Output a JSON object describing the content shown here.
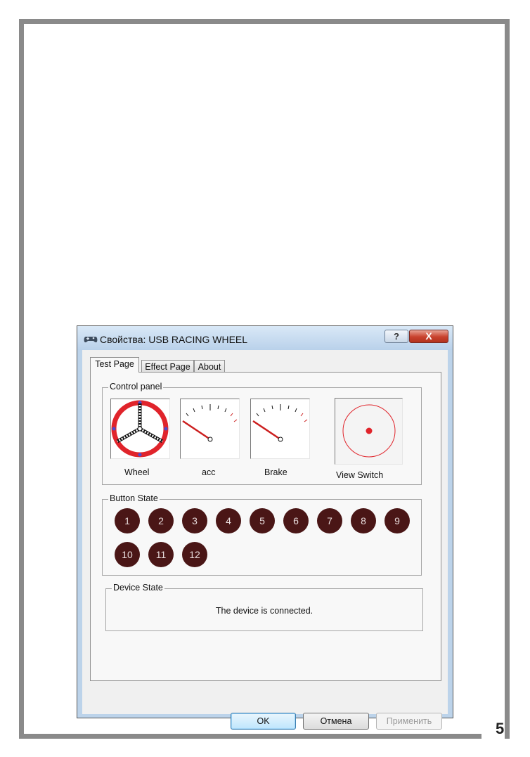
{
  "page": {
    "number": "5"
  },
  "window": {
    "title": "Свойства: USB RACING WHEEL",
    "help_label": "?",
    "close_label": "X"
  },
  "tabs": [
    {
      "label": "Test Page",
      "active": true
    },
    {
      "label": "Effect Page",
      "active": false
    },
    {
      "label": "About",
      "active": false
    }
  ],
  "control_panel": {
    "legend": "Control panel",
    "wheel_label": "Wheel",
    "acc_label": "acc",
    "brake_label": "Brake",
    "view_switch_label": "View Switch"
  },
  "button_state": {
    "legend": "Button State",
    "buttons": [
      "1",
      "2",
      "3",
      "4",
      "5",
      "6",
      "7",
      "8",
      "9",
      "10",
      "11",
      "12"
    ]
  },
  "device_state": {
    "legend": "Device State",
    "status": "The device is connected."
  },
  "footer": {
    "ok_label": "OK",
    "cancel_label": "Отмена",
    "apply_label": "Применить"
  },
  "colors": {
    "wheel_ring": "#e0242b",
    "button_fill": "#4a1616",
    "needle": "#cc1f1f"
  }
}
